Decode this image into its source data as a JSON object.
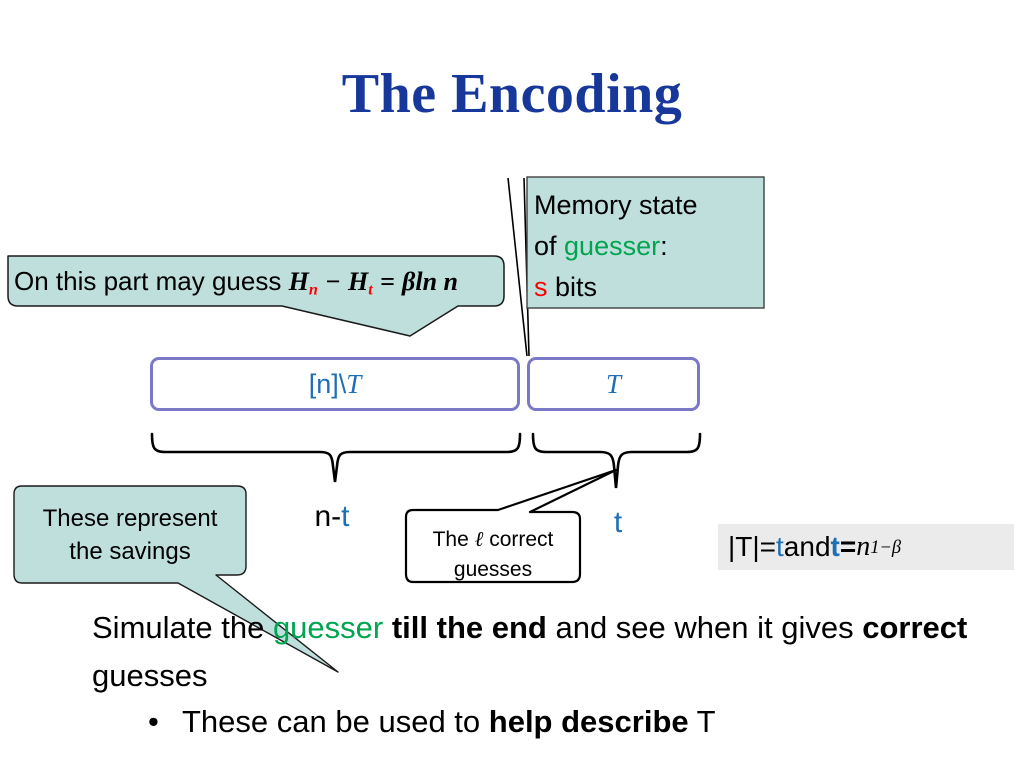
{
  "title": "The Encoding",
  "memory_state_callout": {
    "line1": "Memory state",
    "line2_prefix": "of ",
    "line2_emphasis": "guesser",
    "line2_suffix": ":",
    "line3_emphasis": "s",
    "line3_suffix": " bits",
    "emphasis_color": "#00a550",
    "symbol_color": "#ff0000",
    "fill_color": "#bfdfdc"
  },
  "guess_part_callout": {
    "text": "On this part may guess",
    "formula": {
      "h_n": "H",
      "h_n_sub": "n",
      "minus": "−",
      "h_t": "H",
      "h_t_sub": "t",
      "equals": "=",
      "rhs": "βln n"
    },
    "fill_color": "#bfdfdc"
  },
  "boxes": {
    "left": {
      "prefix": "[n]\\",
      "symbol": "T"
    },
    "right": {
      "symbol": "T"
    },
    "border_color": "#7b78c8",
    "text_color": "#1f6fb5"
  },
  "brace_labels": {
    "left": {
      "prefix": "n-",
      "symbol": "t"
    },
    "right": {
      "symbol": "t"
    }
  },
  "savings_callout": {
    "line1": "These represent",
    "line2": "the savings",
    "fill_color": "#bfdfdc"
  },
  "correct_guesses_callout": {
    "line1_prefix": "The ",
    "line1_symbol": "ℓ",
    "line1_suffix": " correct",
    "line2": "guesses",
    "fill_color": "#ffffff"
  },
  "t_size_formula": {
    "abs_t": "|T|",
    "eq1": "=",
    "t1": "t",
    "and": " and ",
    "t2": "t",
    "eq2": "=",
    "n": "n",
    "exponent": "1−β",
    "background": "#ebebeb"
  },
  "body_text": {
    "seg1": "Simulate the ",
    "seg2_emphasis": "guesser",
    "seg3_bold": " till the end",
    "seg4": " and see when it gives ",
    "seg5_bold": "correct",
    "seg6": " guesses"
  },
  "bullet": {
    "marker": "•",
    "seg1": "These can be used to ",
    "seg2_bold": "help describe",
    "seg3": " T"
  }
}
